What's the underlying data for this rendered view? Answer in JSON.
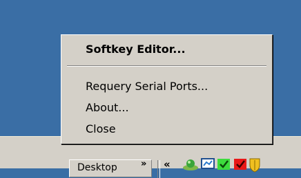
{
  "menu": {
    "items": [
      {
        "label": "Softkey Editor...",
        "default": true
      },
      {
        "label": "Requery Serial Ports..."
      },
      {
        "label": "About..."
      },
      {
        "label": "Close"
      }
    ]
  },
  "taskbar": {
    "desktop_label": "Desktop",
    "desktop_chevron": "»",
    "tray_expand": "«",
    "tray_icons": [
      "green-orb-icon",
      "network-monitor-icon",
      "green-checkmark-icon",
      "red-checkmark-icon",
      "yellow-shield-icon"
    ]
  },
  "colors": {
    "desktop": "#3a6ea5",
    "menu_face": "#d4d0c8"
  }
}
